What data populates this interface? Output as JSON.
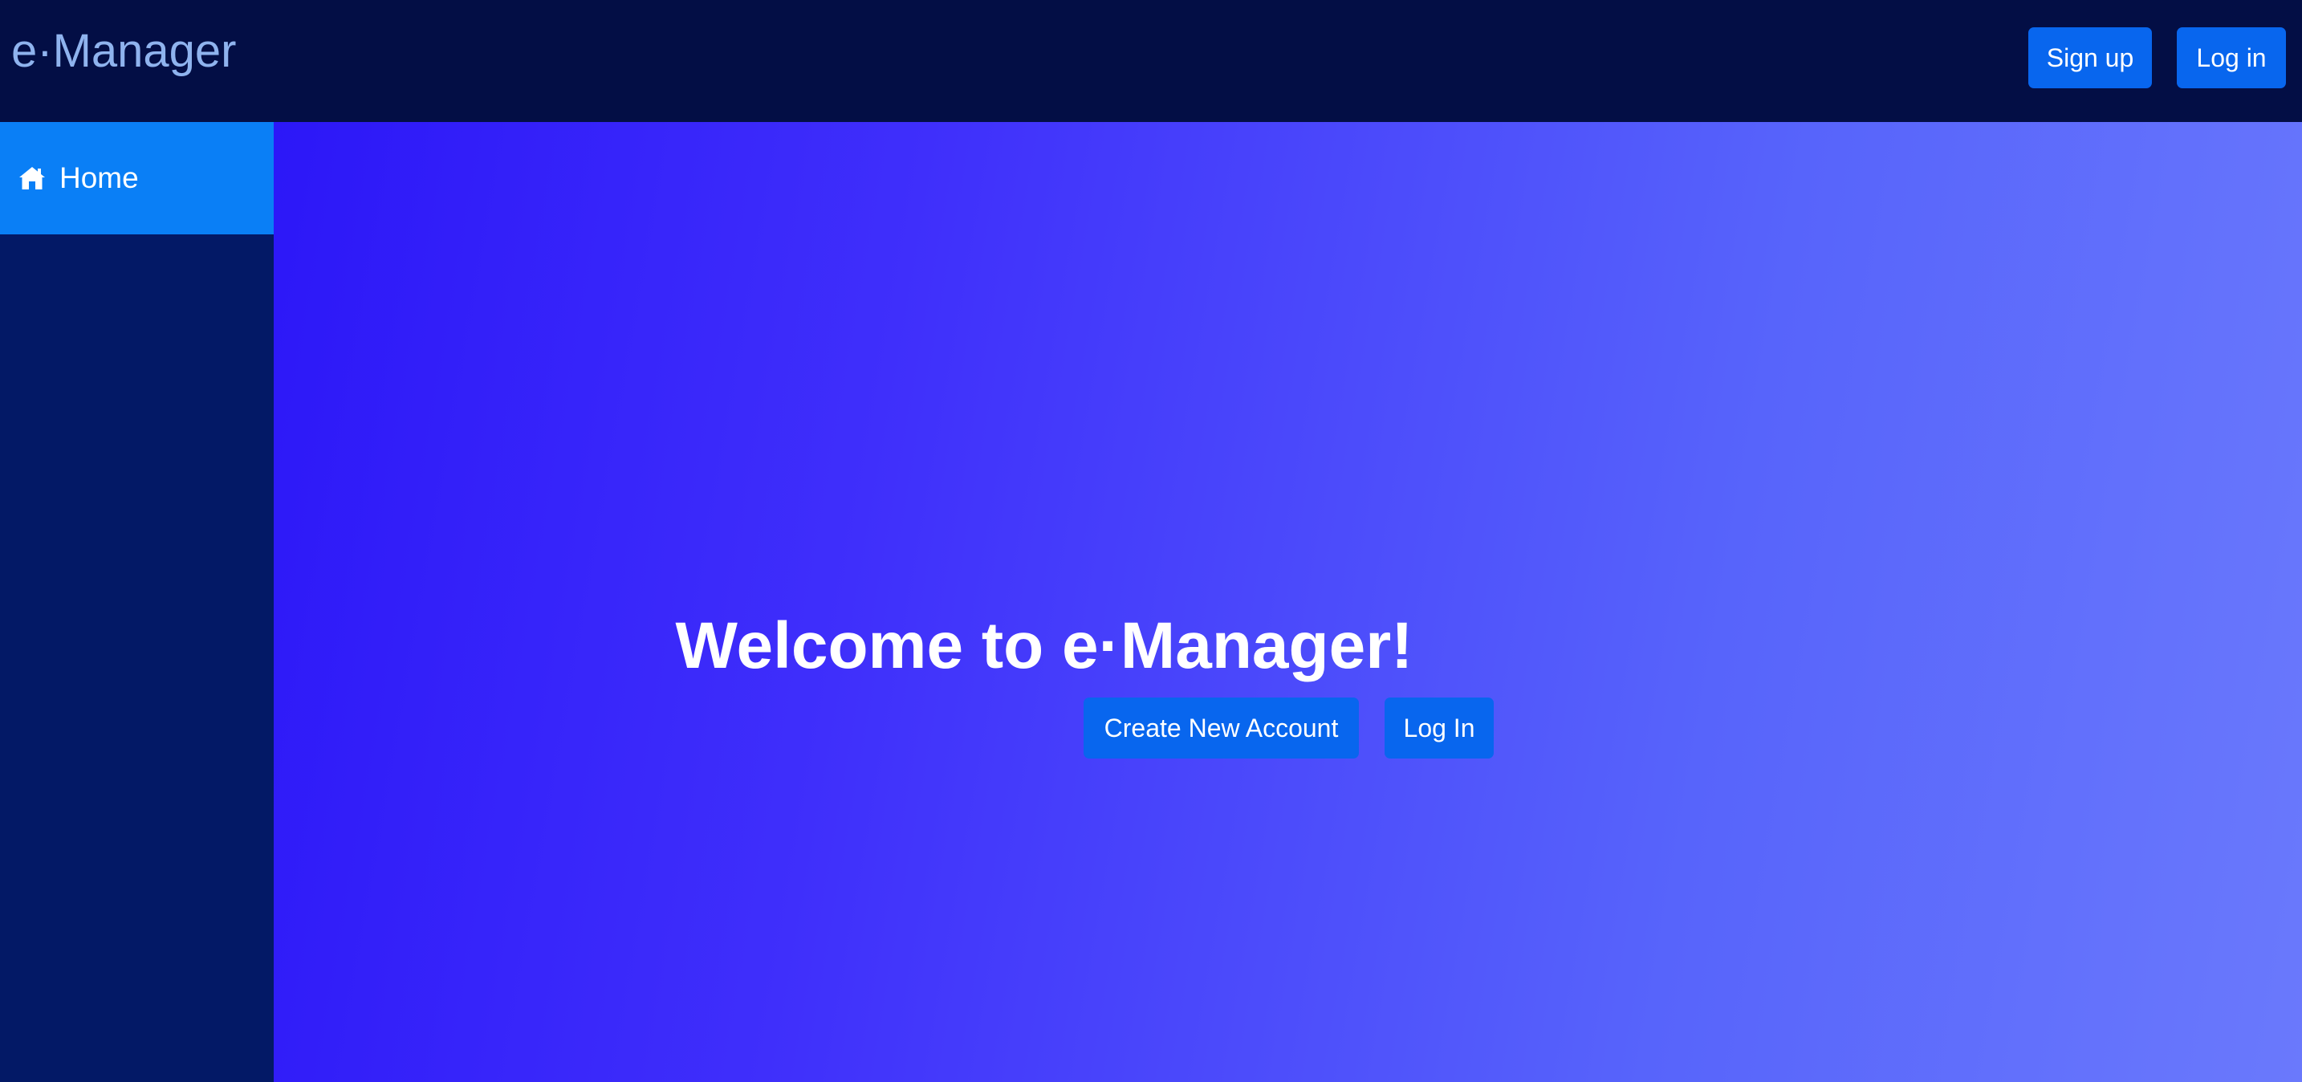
{
  "header": {
    "brand": "e·Manager",
    "signup_label": "Sign up",
    "login_label": "Log in"
  },
  "sidebar": {
    "items": [
      {
        "label": "Home",
        "icon": "home-icon",
        "active": true
      }
    ]
  },
  "main": {
    "title": "Welcome to e·Manager!",
    "create_label": "Create New Account",
    "login_label": "Log In"
  },
  "colors": {
    "header_bg": "#030e45",
    "sidebar_bg": "#031966",
    "sidebar_active": "#0a7ff6",
    "button": "#0866ee",
    "brand_text": "#8fb3ee",
    "gradient_start": "#2c17f8",
    "gradient_end": "#6a79fc"
  }
}
